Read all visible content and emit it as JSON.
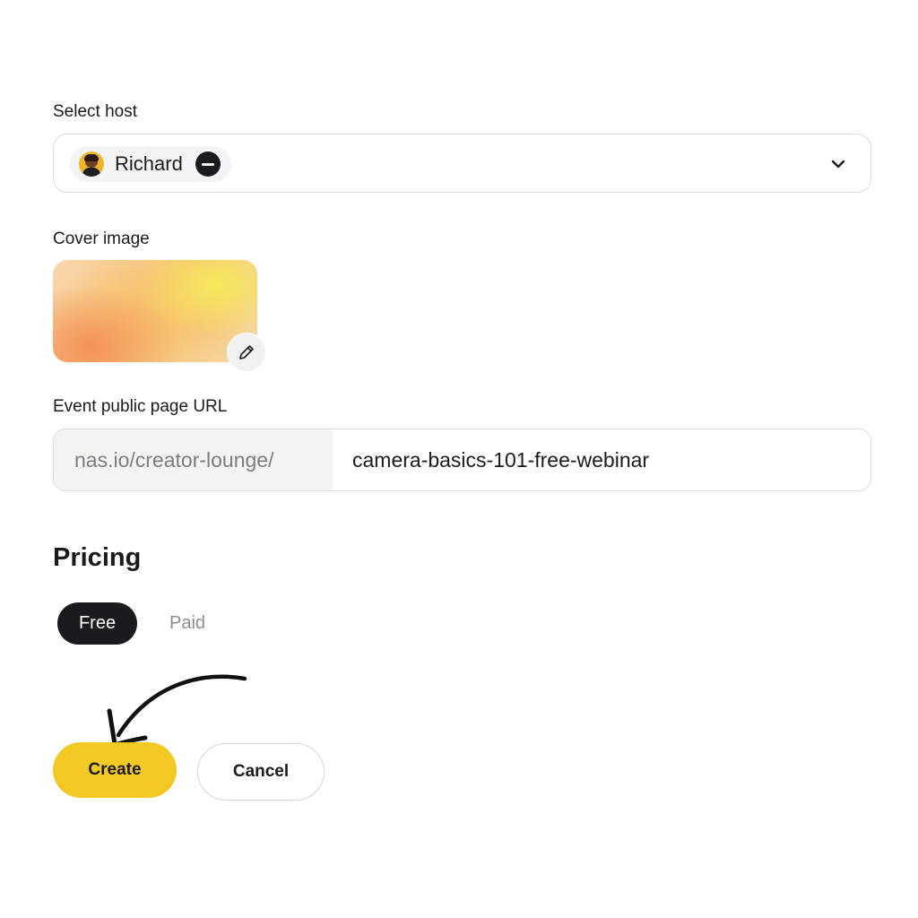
{
  "host": {
    "label": "Select host",
    "selected_name": "Richard"
  },
  "cover": {
    "label": "Cover image"
  },
  "url": {
    "label": "Event public page URL",
    "prefix": "nas.io/creator-lounge/",
    "slug": "camera-basics-101-free-webinar"
  },
  "pricing": {
    "title": "Pricing",
    "options": [
      "Free",
      "Paid"
    ],
    "selected": "Free"
  },
  "actions": {
    "create_label": "Create",
    "cancel_label": "Cancel"
  },
  "colors": {
    "accent": "#f5c924",
    "dark": "#1b1b1f"
  }
}
